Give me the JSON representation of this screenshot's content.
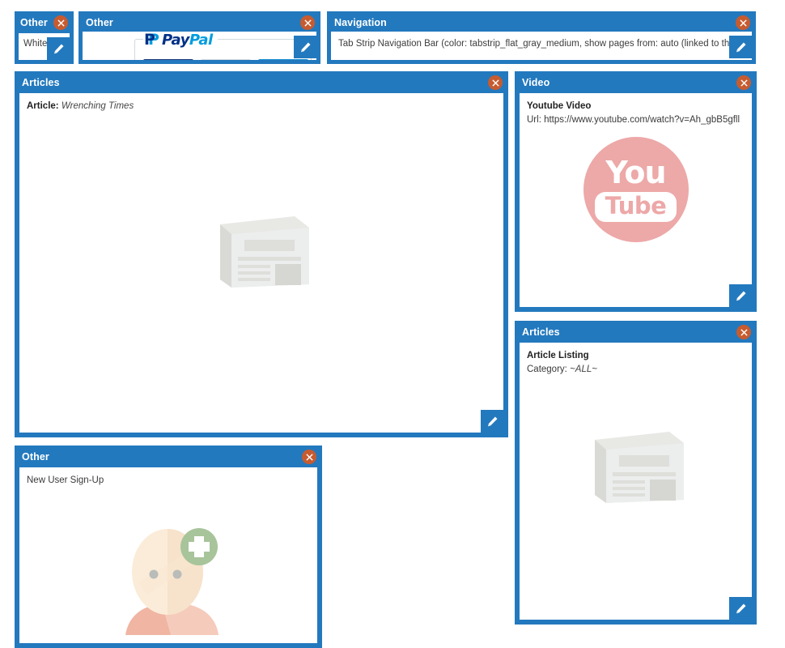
{
  "theme": {
    "panel_blue": "#2379be",
    "close_orange": "#c75b30",
    "body_white": "#ffffff",
    "youtube_pink": "#eda8a8",
    "placeholder_gray": "#e2e3df"
  },
  "panels": {
    "whitespace": {
      "title": "Other",
      "text": "Whitespace",
      "close_icon": "close-x-icon",
      "edit_icon": "pencil-icon"
    },
    "paypal": {
      "title": "Other",
      "logo_p": "P",
      "logo_pay": "Pay",
      "logo_pal": "Pal",
      "close_icon": "close-x-icon",
      "edit_icon": "pencil-icon"
    },
    "navigation": {
      "title": "Navigation",
      "text": "Tab Strip Navigation Bar (color: tabstrip_flat_gray_medium, show pages from: auto (linked to this page's page group)",
      "close_icon": "close-x-icon",
      "edit_icon": "pencil-icon"
    },
    "article": {
      "title": "Articles",
      "label": "Article:",
      "value": "Wrenching Times",
      "placeholder_icon": "newspaper-icon",
      "close_icon": "close-x-icon",
      "edit_icon": "pencil-icon"
    },
    "video": {
      "title": "Video",
      "heading": "Youtube Video",
      "url_line": "Url: https://www.youtube.com/watch?v=Ah_gbB5gfll",
      "logo_you": "You",
      "logo_tube": "Tube",
      "close_icon": "close-x-icon",
      "edit_icon": "pencil-icon"
    },
    "article_listing": {
      "title": "Articles",
      "heading": "Article Listing",
      "category_label": "Category:",
      "category_value": "~ALL~",
      "placeholder_icon": "newspaper-icon",
      "close_icon": "close-x-icon",
      "edit_icon": "pencil-icon"
    },
    "signup": {
      "title": "Other",
      "text": "New User Sign-Up",
      "placeholder_icon": "add-user-avatar-icon",
      "close_icon": "close-x-icon"
    }
  }
}
